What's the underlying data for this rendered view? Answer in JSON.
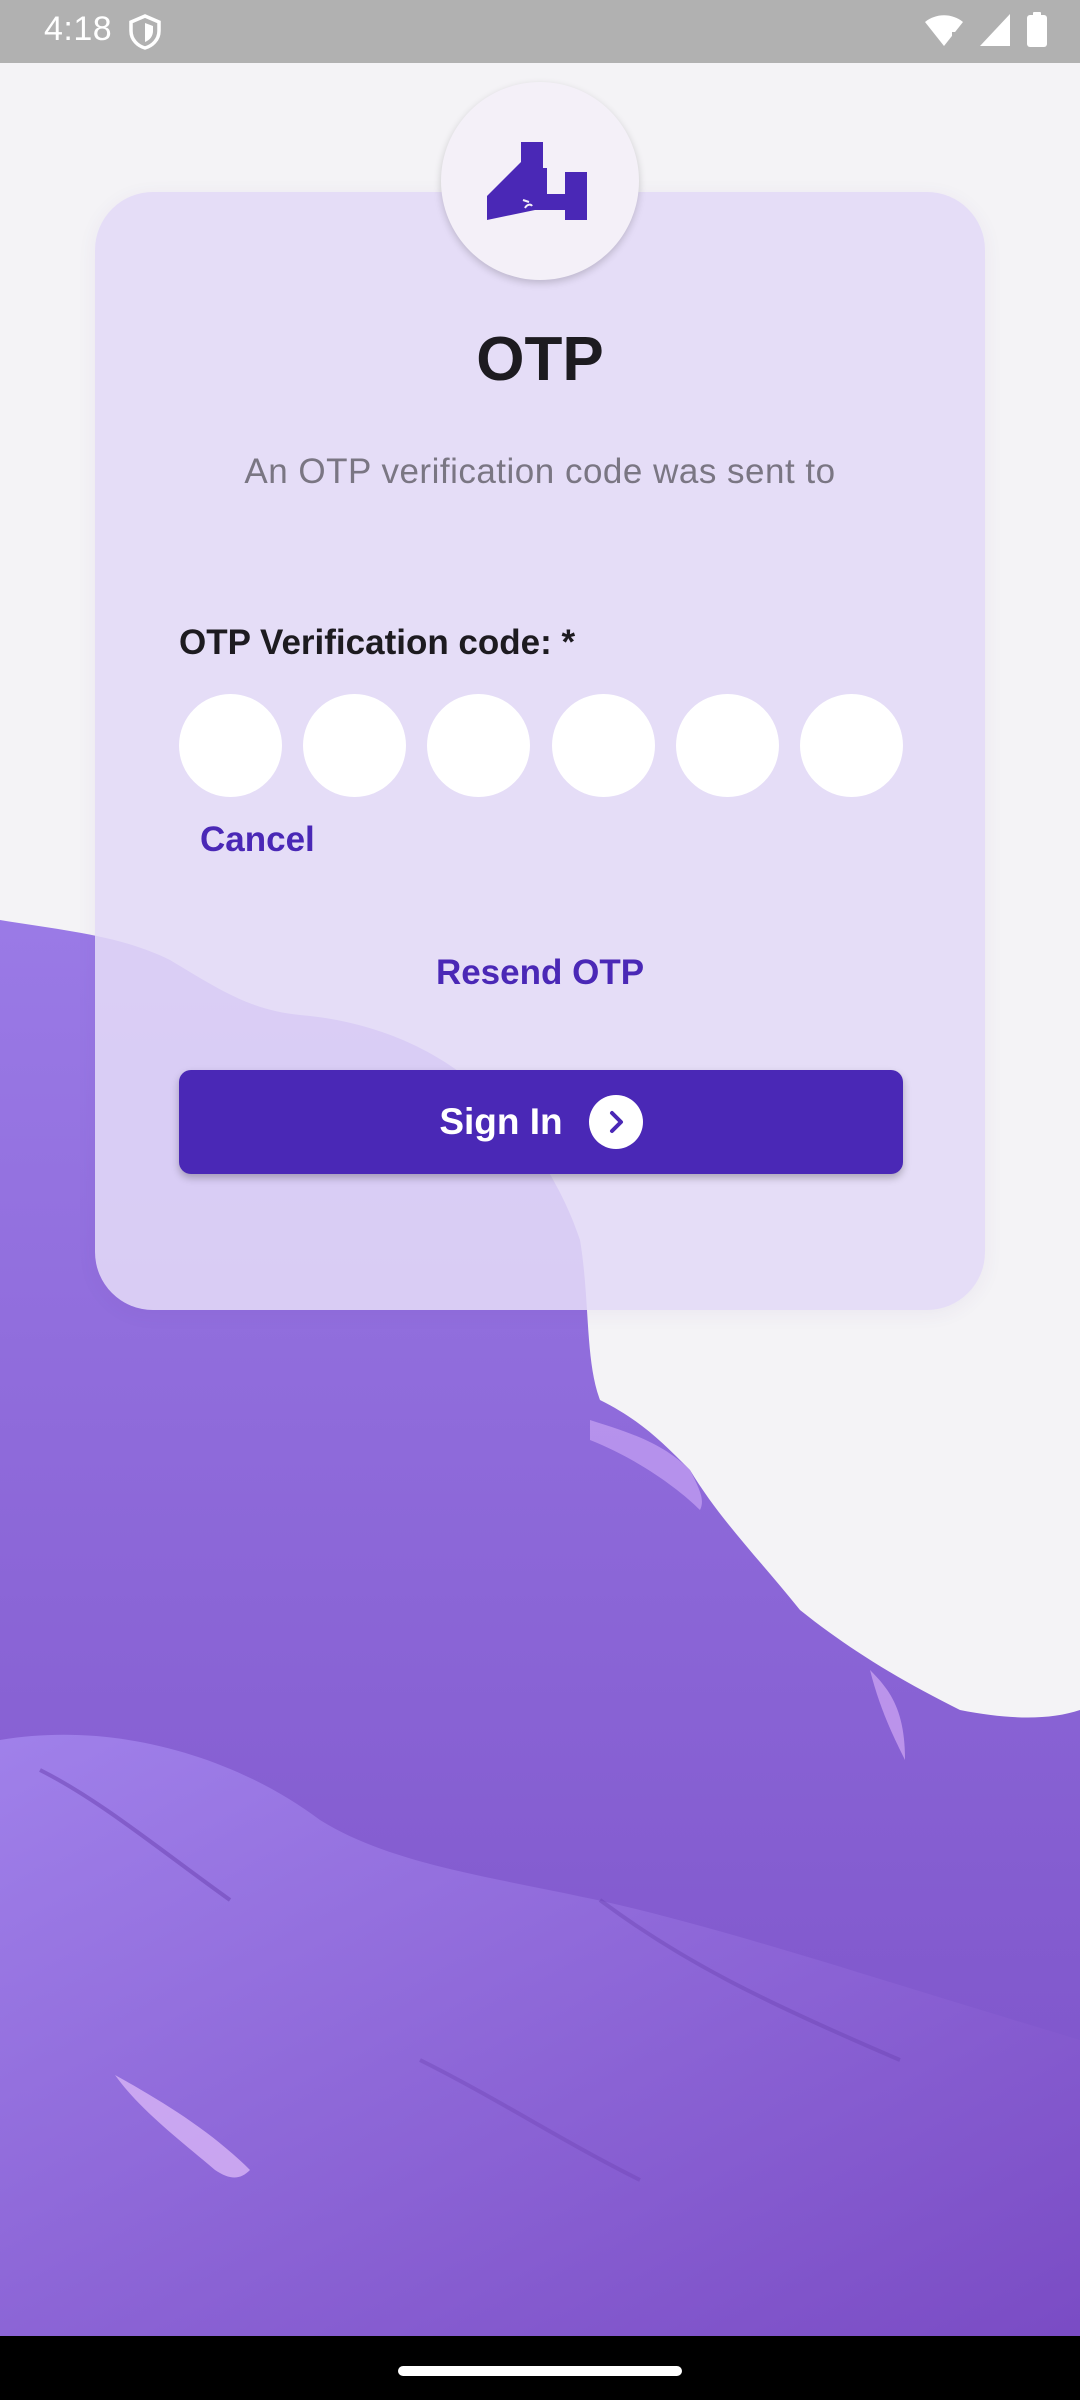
{
  "status_bar": {
    "time": "4:18"
  },
  "icons": {
    "shield": "shield-icon",
    "wifi": "wifi-icon",
    "signal": "signal-icon",
    "battery": "battery-icon",
    "logo": "app-logo",
    "arrow": "chevron-right-icon"
  },
  "otp_screen": {
    "title": "OTP",
    "subtitle": "An OTP verification code was sent to",
    "field_label": "OTP Verification code: *",
    "digit_count": 6,
    "cancel_label": "Cancel",
    "resend_label": "Resend OTP",
    "signin_label": "Sign In"
  },
  "colors": {
    "accent": "#4a28b6",
    "card": "#e2d9f7",
    "background": "#f4f3f6",
    "background_art": "#7f56d6"
  }
}
